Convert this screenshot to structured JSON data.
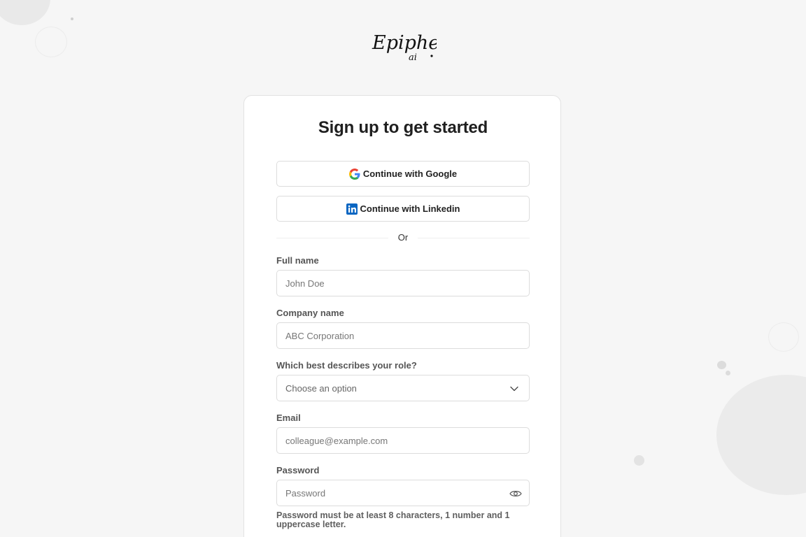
{
  "brand": {
    "logo_text": "Epipheo",
    "logo_subtext": "ai"
  },
  "signup": {
    "title": "Sign up to get started",
    "google_label": "Continue with Google",
    "linkedin_label": "Continue with Linkedin",
    "divider_text": "Or"
  },
  "form": {
    "full_name": {
      "label": "Full name",
      "placeholder": "John Doe",
      "value": ""
    },
    "company": {
      "label": "Company name",
      "placeholder": "ABC Corporation",
      "value": ""
    },
    "role": {
      "label": "Which best describes your role?",
      "selected": "Choose an option"
    },
    "email": {
      "label": "Email",
      "placeholder": "colleague@example.com",
      "value": ""
    },
    "password": {
      "label": "Password",
      "placeholder": "Password",
      "value": "",
      "hint": "Password must be at least 8 characters, 1 number and 1 uppercase letter."
    }
  },
  "icons": {
    "google": "google-icon",
    "linkedin": "linkedin-icon",
    "chevron": "chevron-down-icon",
    "eye": "eye-icon"
  },
  "colors": {
    "background": "#f6f6f6",
    "card": "#ffffff",
    "border": "#dcdcdc",
    "linkedin_blue": "#0a66c2"
  }
}
